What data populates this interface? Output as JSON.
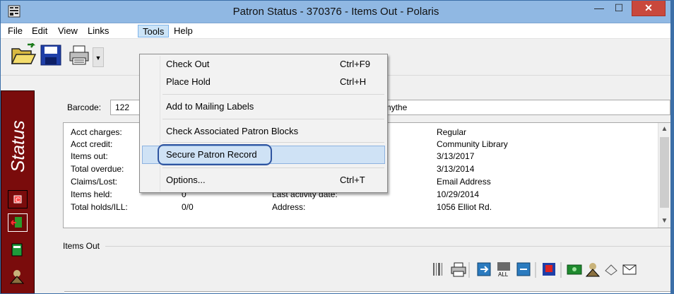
{
  "window": {
    "title": "Patron Status - 370376 - Items Out - Polaris",
    "controls": {
      "minimize": "—",
      "maximize": "☐",
      "close": "✕"
    }
  },
  "menubar": {
    "items": [
      {
        "label": "File"
      },
      {
        "label": "Edit"
      },
      {
        "label": "View"
      },
      {
        "label": "Links"
      },
      {
        "label": "Tools"
      },
      {
        "label": "Help"
      }
    ],
    "active": "Tools"
  },
  "toolbar": {
    "icons": [
      "open-folder-icon",
      "save-icon",
      "print-icon",
      "dropdown-arrow-icon"
    ]
  },
  "sidebar": {
    "title": "Status",
    "icons": [
      "checkout-icon",
      "items-out-icon",
      "register-icon",
      "patron-icon"
    ],
    "colors": {
      "background": "#7a0c0c",
      "title": "#ffffff"
    }
  },
  "patron": {
    "barcode_label": "Barcode:",
    "barcode_value": "122",
    "name_value": "rold T Smythe"
  },
  "summary": {
    "left": [
      {
        "label": "Acct charges:",
        "value": ""
      },
      {
        "label": "Acct credit:",
        "value": ""
      },
      {
        "label": "Items out:",
        "value": ""
      },
      {
        "label": "Total overdue:",
        "value": ""
      },
      {
        "label": "Claims/Lost:",
        "value": ""
      },
      {
        "label": "Items held:",
        "value": "0"
      },
      {
        "label": "Total holds/ILL:",
        "value": "0/0"
      }
    ],
    "right": [
      {
        "label": "",
        "value": "Regular"
      },
      {
        "label": "",
        "value": "Community Library"
      },
      {
        "label": "",
        "value": "3/13/2017"
      },
      {
        "label": "",
        "value": "3/13/2014"
      },
      {
        "label": "",
        "value": "Email Address"
      },
      {
        "label": "Last activity date:",
        "value": "10/29/2014"
      },
      {
        "label": "Address:",
        "value": "1056 Elliot Rd."
      }
    ]
  },
  "items_out": {
    "group_label": "Items Out",
    "toolbar_icons": [
      "barcode-scan-icon",
      "print-icon",
      "renew-icon",
      "renew-all-icon",
      "renew-selected-icon",
      "bill-icon",
      "money-icon",
      "claim-icon",
      "lost-icon",
      "email-icon"
    ],
    "renew_all_text": "ALL"
  },
  "tools_menu": {
    "items": [
      {
        "label": "Check Out",
        "shortcut": "Ctrl+F9"
      },
      {
        "label": "Place Hold",
        "shortcut": "Ctrl+H"
      },
      {
        "label": "Add to Mailing Labels",
        "shortcut": ""
      },
      {
        "label": "Check Associated Patron Blocks",
        "shortcut": ""
      },
      {
        "label": "Secure Patron Record",
        "shortcut": ""
      },
      {
        "label": "Options...",
        "shortcut": "Ctrl+T"
      }
    ],
    "highlighted": "Secure Patron Record",
    "colors": {
      "highlight": "#cfe2f5",
      "callout": "#2f55a0"
    }
  }
}
